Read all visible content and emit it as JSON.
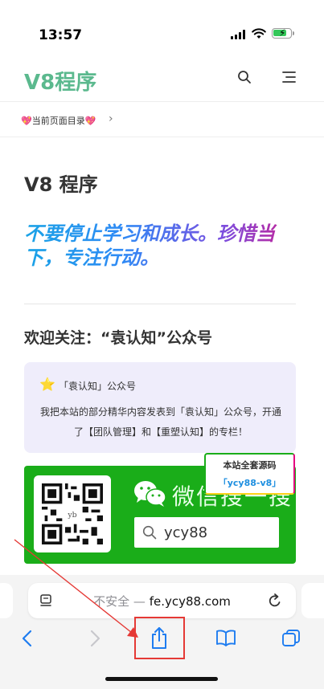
{
  "status_bar": {
    "time": "13:57"
  },
  "header": {
    "site_title": "V8程序"
  },
  "toc": {
    "label": "💖当前页面目录💖",
    "arrow": "›"
  },
  "article": {
    "title": "V8 程序",
    "motto": "不要停止学习和成长。珍惜当下，专注行动。",
    "follow_heading": "欢迎关注：“袁认知”公众号"
  },
  "notice": {
    "star": "⭐",
    "title": "「袁认知」公众号",
    "body": "我把本站的部分精华内容发表到「袁认知」公众号，开通了【团队管理】和【重塑认知】的专栏！"
  },
  "wechat_card": {
    "qr_center": "yb",
    "search_label": "微信搜一搜",
    "search_query": "ycy88"
  },
  "source_badge": {
    "line1": "本站全套源码",
    "line2": "「ycy88-v8」"
  },
  "browser": {
    "insecure_label": "不安全 — ",
    "domain": "fe.ycy88.com"
  },
  "colors": {
    "brand_green": "#5bb98e",
    "wechat_green": "#1aad19",
    "ios_blue": "#1e7cf0",
    "annotation_red": "#e53935"
  },
  "icons": [
    "search-icon",
    "menu-icon",
    "star-icon",
    "wechat-logo-icon",
    "reader-icon",
    "reload-icon",
    "back-icon",
    "forward-icon",
    "share-icon",
    "bookmarks-icon",
    "tabs-icon"
  ]
}
